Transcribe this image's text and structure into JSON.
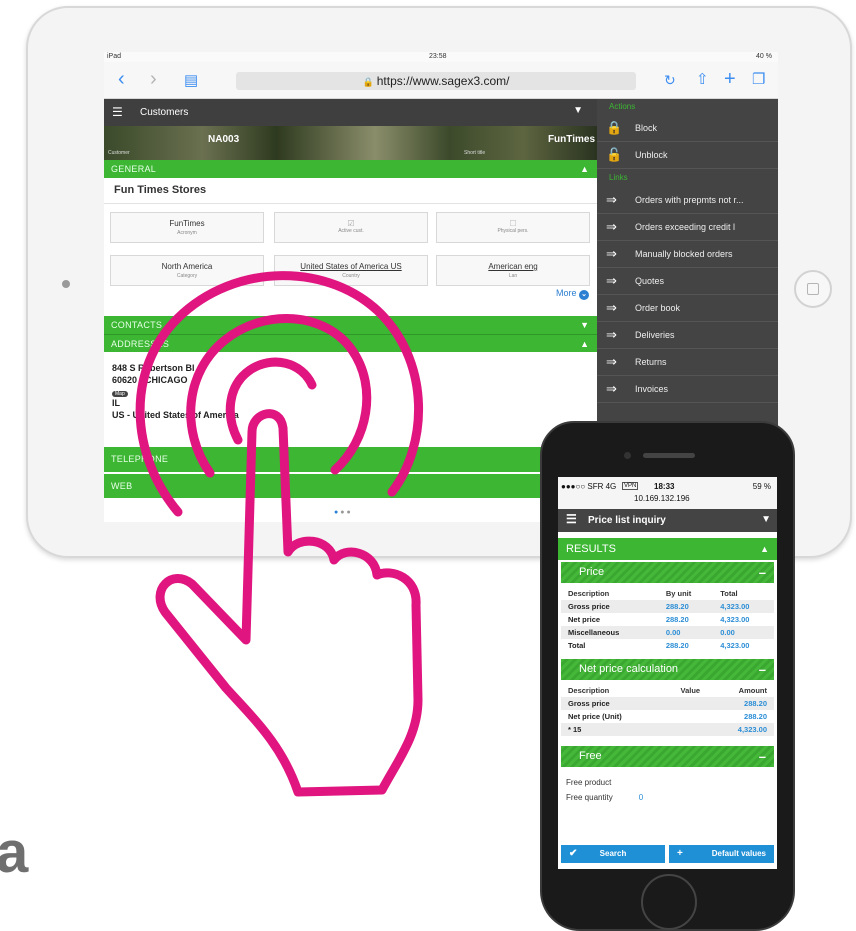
{
  "tablet": {
    "status": {
      "carrier": "iPad",
      "time": "23:58",
      "battery": "40 %"
    },
    "url": "https://www.sagex3.com/",
    "app_title": "Customers",
    "banner": {
      "code": "NA003",
      "name": "FunTimes",
      "code_sub": "Customer",
      "name_sub": "Short title"
    },
    "sections": {
      "general": "GENERAL",
      "contacts": "CONTACTS",
      "addresses": "ADDRESSES",
      "telephone": "TELEPHONE",
      "web": "WEB"
    },
    "customer_name": "Fun Times Stores",
    "fields": [
      {
        "value": "FunTimes",
        "label": "Acronym"
      },
      {
        "value": "",
        "label": "Active cust."
      },
      {
        "value": "",
        "label": "Physical pers."
      },
      {
        "value": "North America",
        "label": "Category"
      },
      {
        "value": "United States of America US",
        "label": "Country"
      },
      {
        "value": "American eng",
        "label": "Lan"
      }
    ],
    "more": "More",
    "address": {
      "line1": "848 S Robertson Bl",
      "line2": "60620 - CHICAGO",
      "badge": "Map",
      "line3": "IL",
      "line4": "US - United States of America"
    },
    "sidebar": {
      "actions_header": "Actions",
      "links_header": "Links",
      "actions": [
        "Block",
        "Unblock"
      ],
      "links": [
        "Orders with prepmts not r...",
        "Orders exceeding credit l",
        "Manually blocked orders",
        "Quotes",
        "Order book",
        "Deliveries",
        "Returns",
        "Invoices"
      ]
    }
  },
  "phone": {
    "status": {
      "carrier": "●●●○○ SFR 4G",
      "vpn": "VPN",
      "time": "18:33",
      "battery": "59 %",
      "ip": "10.169.132.196"
    },
    "title": "Price list inquiry",
    "results": "RESULTS",
    "price": {
      "header": "Price",
      "columns": [
        "Description",
        "By unit",
        "Total"
      ],
      "rows": [
        {
          "label": "Gross price",
          "unit": "288.20",
          "total": "4,323.00"
        },
        {
          "label": "Net price",
          "unit": "288.20",
          "total": "4,323.00"
        },
        {
          "label": "Miscellaneous",
          "unit": "0.00",
          "total": "0.00"
        },
        {
          "label": "Total",
          "unit": "288.20",
          "total": "4,323.00"
        }
      ]
    },
    "net": {
      "header": "Net price calculation",
      "columns": [
        "Description",
        "Value",
        "Amount"
      ],
      "rows": [
        {
          "label": "Gross price",
          "value": "",
          "amount": "288.20"
        },
        {
          "label": "Net price (Unit)",
          "value": "",
          "amount": "288.20"
        },
        {
          "label": "* 15",
          "value": "",
          "amount": "4,323.00"
        }
      ]
    },
    "free": {
      "header": "Free",
      "product_label": "Free product",
      "quantity_label": "Free quantity",
      "quantity": "0"
    },
    "buttons": {
      "search": "Search",
      "defaults": "Default values"
    }
  },
  "caption_letter": "a",
  "colors": {
    "green": "#3cb633",
    "blue": "#1f8fd6",
    "magenta": "#e0157f",
    "dark": "#444444"
  }
}
